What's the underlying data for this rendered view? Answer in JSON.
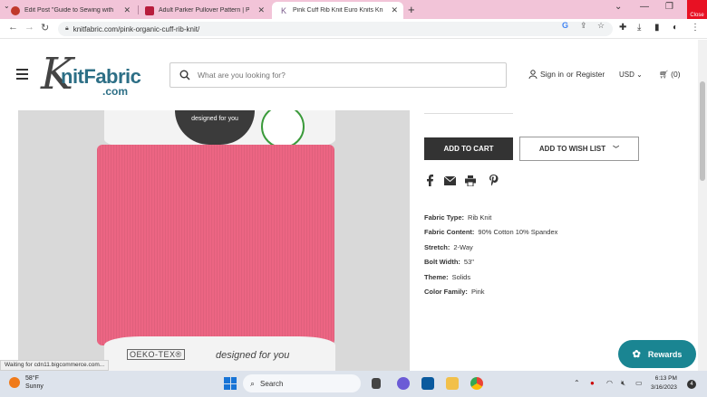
{
  "browser": {
    "tabs": [
      {
        "title": "Edit Post \"Guide to Sewing with",
        "favicon_color": "#c0392b",
        "active": false
      },
      {
        "title": "Adult Parker Pullover Pattern | PD",
        "favicon_color": "#b71c3c",
        "active": false
      },
      {
        "title": "Pink Cuff Rib Knit Euro Knits Knit",
        "favicon_color": "#7a5b8c",
        "active": true
      }
    ],
    "close_tooltip": "Close",
    "url": "knitfabric.com/pink-organic-cuff-rib-knit/",
    "new_tab_symbol": "+"
  },
  "site": {
    "logo": {
      "k": "K",
      "main": "nitFabric",
      "suffix": ".com"
    },
    "search_placeholder": "What are you looking for?",
    "account": {
      "sign_in": "Sign in",
      "or": "or",
      "register": "Register"
    },
    "currency": "USD",
    "cart_count": "(0)"
  },
  "product": {
    "image_text": {
      "badge": "designed for you",
      "oeko": "OEKO-TEX®",
      "designed_for": "designed for you"
    },
    "buttons": {
      "add_to_cart": "ADD TO CART",
      "add_to_wish_list": "ADD TO WISH LIST"
    },
    "share_icons": [
      "facebook-icon",
      "email-icon",
      "print-icon",
      "pinterest-icon"
    ],
    "specs": [
      {
        "label": "Fabric Type:",
        "value": "Rib Knit"
      },
      {
        "label": "Fabric Content:",
        "value": "90% Cotton 10% Spandex"
      },
      {
        "label": "Stretch:",
        "value": "2-Way"
      },
      {
        "label": "Bolt Width:",
        "value": "53\""
      },
      {
        "label": "Theme:",
        "value": "Solids"
      },
      {
        "label": "Color Family:",
        "value": "Pink"
      }
    ]
  },
  "status": "Waiting for cdn11.bigcommerce.com...",
  "rewards_label": "Rewards",
  "taskbar": {
    "weather": {
      "temp": "58°F",
      "condition": "Sunny"
    },
    "search_label": "Search",
    "time": "6:13 PM",
    "date": "3/16/2023",
    "notifications": "4"
  },
  "colors": {
    "brand": "#2d6f86",
    "fabric": "#ec6583",
    "rewards": "#1a8592",
    "tabstrip": "#f2c4d8"
  }
}
